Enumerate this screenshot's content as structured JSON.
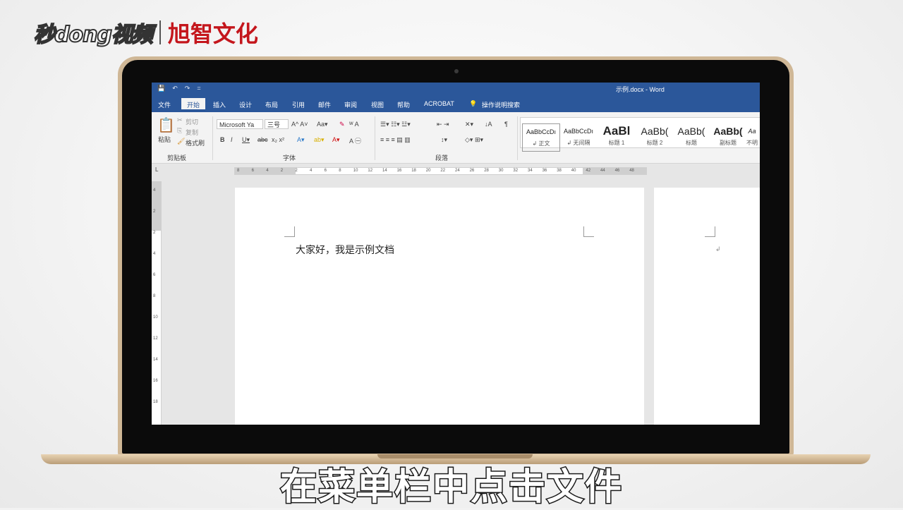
{
  "branding": {
    "logo_left": "秒dong视频",
    "logo_right": "旭智文化"
  },
  "word": {
    "title": "示例.docx  -  Word",
    "qat": [
      "💾",
      "↶",
      "↷",
      "="
    ],
    "tabs": [
      "文件",
      "开始",
      "插入",
      "设计",
      "布局",
      "引用",
      "邮件",
      "审阅",
      "视图",
      "帮助",
      "ACROBAT",
      "操作说明搜索"
    ],
    "active_tab_index": 1,
    "clipboard": {
      "paste": "粘贴",
      "cut": "剪切",
      "copy": "复制",
      "format_painter": "格式刷",
      "label": "剪贴板"
    },
    "font": {
      "name": "Microsoft Ya",
      "size": "三号",
      "label": "字体"
    },
    "paragraph": {
      "label": "段落"
    },
    "styles": [
      {
        "preview": "AaBbCcDı",
        "name": "↲ 正文"
      },
      {
        "preview": "AaBbCcDı",
        "name": "↲ 无间隔"
      },
      {
        "preview": "AaBl",
        "name": "标题 1"
      },
      {
        "preview": "AaBb(",
        "name": "标题 2"
      },
      {
        "preview": "AaBb(",
        "name": "标题"
      },
      {
        "preview": "AaBb(",
        "name": "副标题"
      },
      {
        "preview": "Aa",
        "name": "不明"
      }
    ],
    "ruler_numbers": [
      "8",
      "6",
      "4",
      "2",
      "2",
      "4",
      "6",
      "8",
      "10",
      "12",
      "14",
      "16",
      "18",
      "20",
      "22",
      "24",
      "26",
      "28",
      "30",
      "32",
      "34",
      "36",
      "38",
      "40",
      "42",
      "44",
      "46",
      "48"
    ],
    "vruler_numbers": [
      "4",
      "2",
      "2",
      "4",
      "6",
      "8",
      "10",
      "12",
      "14",
      "16",
      "18"
    ],
    "document_text": "大家好，我是示例文档",
    "page2_mark": "↲"
  },
  "subtitle": "在菜单栏中点击文件",
  "colors": {
    "word_blue": "#2b579a",
    "laptop_gold": "#cfb796",
    "logo_red": "#c4161c"
  }
}
